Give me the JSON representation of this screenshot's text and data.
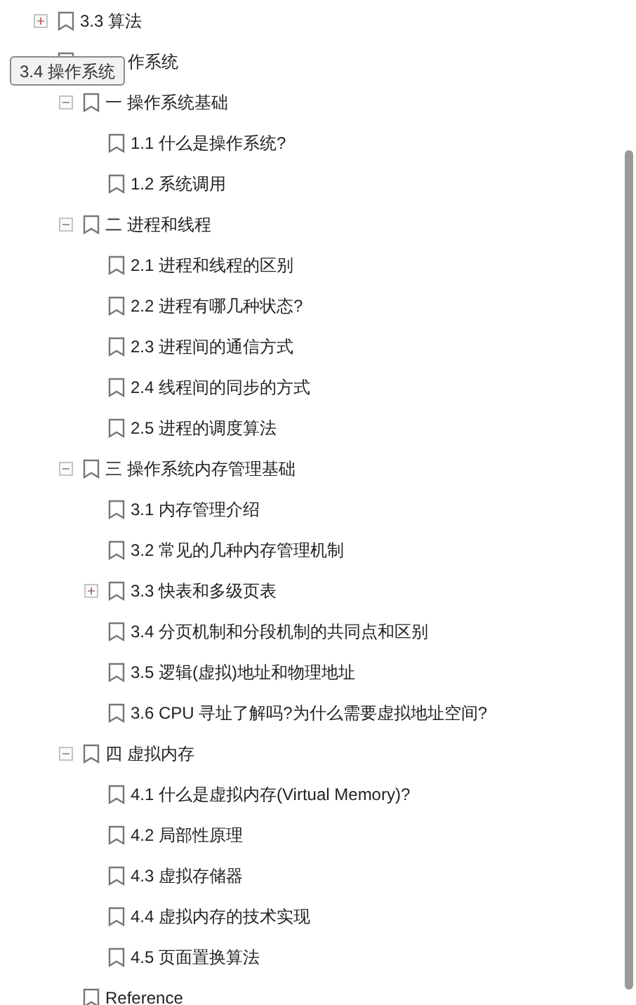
{
  "tree": [
    {
      "label": "3.3 算法",
      "expanded": false
    },
    {
      "label": "作系统",
      "under_tooltip": true,
      "children": [
        {
          "label": "一 操作系统基础",
          "expanded": true,
          "children": [
            {
              "label": "1.1 什么是操作系统?"
            },
            {
              "label": "1.2 系统调用"
            }
          ]
        },
        {
          "label": "二 进程和线程",
          "expanded": true,
          "children": [
            {
              "label": "2.1 进程和线程的区别"
            },
            {
              "label": "2.2 进程有哪几种状态?"
            },
            {
              "label": "2.3 进程间的通信方式"
            },
            {
              "label": "2.4 线程间的同步的方式"
            },
            {
              "label": "2.5 进程的调度算法"
            }
          ]
        },
        {
          "label": "三 操作系统内存管理基础",
          "expanded": true,
          "children": [
            {
              "label": "3.1 内存管理介绍"
            },
            {
              "label": "3.2 常见的几种内存管理机制"
            },
            {
              "label": "3.3 快表和多级页表",
              "expanded": false
            },
            {
              "label": "3.4 分页机制和分段机制的共同点和区别"
            },
            {
              "label": "3.5 逻辑(虚拟)地址和物理地址"
            },
            {
              "label": "3.6 CPU 寻址了解吗?为什么需要虚拟地址空间?"
            }
          ]
        },
        {
          "label": "四 虚拟内存",
          "expanded": true,
          "children": [
            {
              "label": "4.1 什么是虚拟内存(Virtual Memory)?"
            },
            {
              "label": "4.2 局部性原理"
            },
            {
              "label": "4.3 虚拟存储器"
            },
            {
              "label": "4.4 虚拟内存的技术实现"
            },
            {
              "label": "4.5 页面置换算法"
            }
          ]
        },
        {
          "label": "Reference"
        }
      ]
    }
  ],
  "tooltip": {
    "text": "3.4 操作系统"
  }
}
